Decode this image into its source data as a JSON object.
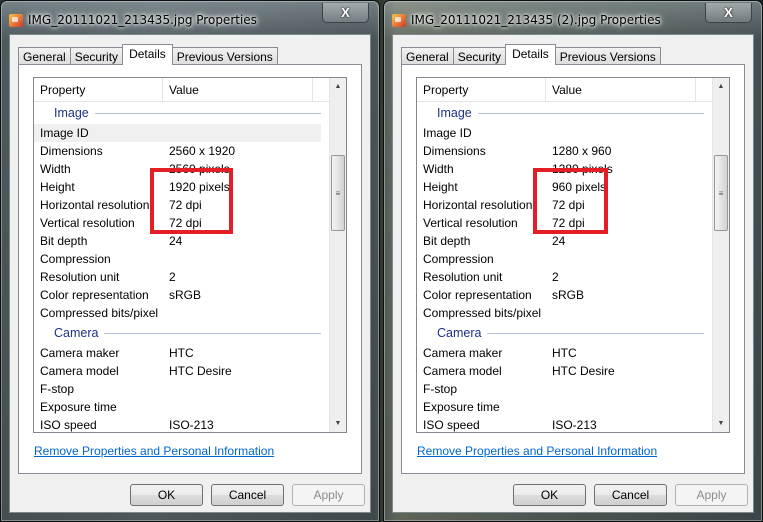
{
  "windows": [
    {
      "title": "IMG_20111021_213435.jpg Properties",
      "close_label": "X",
      "tabs": [
        {
          "label": "General",
          "active": false
        },
        {
          "label": "Security",
          "active": false
        },
        {
          "label": "Details",
          "active": true
        },
        {
          "label": "Previous Versions",
          "active": false
        }
      ],
      "columns": {
        "property": "Property",
        "value": "Value"
      },
      "groups": [
        {
          "name": "Image",
          "rows": [
            {
              "property": "Image ID",
              "value": ""
            },
            {
              "property": "Dimensions",
              "value": "2560 x 1920"
            },
            {
              "property": "Width",
              "value": "2560 pixels"
            },
            {
              "property": "Height",
              "value": "1920 pixels"
            },
            {
              "property": "Horizontal resolution",
              "value": "72 dpi"
            },
            {
              "property": "Vertical resolution",
              "value": "72 dpi"
            },
            {
              "property": "Bit depth",
              "value": "24"
            },
            {
              "property": "Compression",
              "value": ""
            },
            {
              "property": "Resolution unit",
              "value": "2"
            },
            {
              "property": "Color representation",
              "value": "sRGB"
            },
            {
              "property": "Compressed bits/pixel",
              "value": ""
            }
          ]
        },
        {
          "name": "Camera",
          "rows": [
            {
              "property": "Camera maker",
              "value": "HTC"
            },
            {
              "property": "Camera model",
              "value": "HTC Desire"
            },
            {
              "property": "F-stop",
              "value": ""
            },
            {
              "property": "Exposure time",
              "value": ""
            },
            {
              "property": "ISO speed",
              "value": "ISO-213"
            }
          ]
        }
      ],
      "scroll_up_icon": "▲",
      "scroll_down_icon": "▼",
      "scroll_grip_icon": "≡",
      "remove_link": "Remove Properties and Personal Information",
      "buttons": {
        "ok": "OK",
        "cancel": "Cancel",
        "apply": "Apply"
      }
    },
    {
      "title": "IMG_20111021_213435 (2).jpg Properties",
      "close_label": "X",
      "tabs": [
        {
          "label": "General",
          "active": false
        },
        {
          "label": "Security",
          "active": false
        },
        {
          "label": "Details",
          "active": true
        },
        {
          "label": "Previous Versions",
          "active": false
        }
      ],
      "columns": {
        "property": "Property",
        "value": "Value"
      },
      "groups": [
        {
          "name": "Image",
          "rows": [
            {
              "property": "Image ID",
              "value": ""
            },
            {
              "property": "Dimensions",
              "value": "1280 x 960"
            },
            {
              "property": "Width",
              "value": "1280 pixels"
            },
            {
              "property": "Height",
              "value": "960 pixels"
            },
            {
              "property": "Horizontal resolution",
              "value": "72 dpi"
            },
            {
              "property": "Vertical resolution",
              "value": "72 dpi"
            },
            {
              "property": "Bit depth",
              "value": "24"
            },
            {
              "property": "Compression",
              "value": ""
            },
            {
              "property": "Resolution unit",
              "value": "2"
            },
            {
              "property": "Color representation",
              "value": "sRGB"
            },
            {
              "property": "Compressed bits/pixel",
              "value": ""
            }
          ]
        },
        {
          "name": "Camera",
          "rows": [
            {
              "property": "Camera maker",
              "value": "HTC"
            },
            {
              "property": "Camera model",
              "value": "HTC Desire"
            },
            {
              "property": "F-stop",
              "value": ""
            },
            {
              "property": "Exposure time",
              "value": ""
            },
            {
              "property": "ISO speed",
              "value": "ISO-213"
            }
          ]
        }
      ],
      "scroll_up_icon": "▲",
      "scroll_down_icon": "▼",
      "scroll_grip_icon": "≡",
      "remove_link": "Remove Properties and Personal Information",
      "buttons": {
        "ok": "OK",
        "cancel": "Cancel",
        "apply": "Apply"
      }
    }
  ],
  "annotation": {
    "color": "#e31e24",
    "highlighted_rows": [
      "Dimensions",
      "Width",
      "Height"
    ]
  }
}
